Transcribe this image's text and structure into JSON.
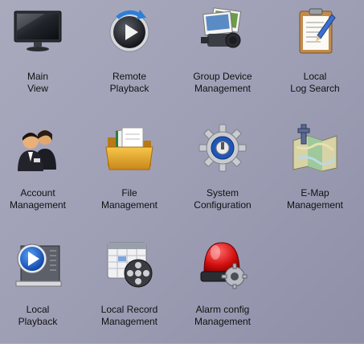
{
  "tiles": [
    {
      "line1": "Main",
      "line2": "View",
      "icon": "monitor-icon"
    },
    {
      "line1": "Remote",
      "line2": "Playback",
      "icon": "remote-playback-icon"
    },
    {
      "line1": "Group Device",
      "line2": "Management",
      "icon": "group-device-icon"
    },
    {
      "line1": "Local",
      "line2": "Log Search",
      "icon": "log-search-icon"
    },
    {
      "line1": "Account",
      "line2": "Management",
      "icon": "account-users-icon"
    },
    {
      "line1": "File",
      "line2": "Management",
      "icon": "folder-icon"
    },
    {
      "line1": "System",
      "line2": "Configuration",
      "icon": "gear-icon"
    },
    {
      "line1": "E-Map",
      "line2": "Management",
      "icon": "map-icon"
    },
    {
      "line1": "Local",
      "line2": "Playback",
      "icon": "local-playback-icon"
    },
    {
      "line1": "Local Record",
      "line2": "Management",
      "icon": "record-calendar-icon"
    },
    {
      "line1": "Alarm config",
      "line2": "Management",
      "icon": "alarm-light-icon"
    }
  ]
}
